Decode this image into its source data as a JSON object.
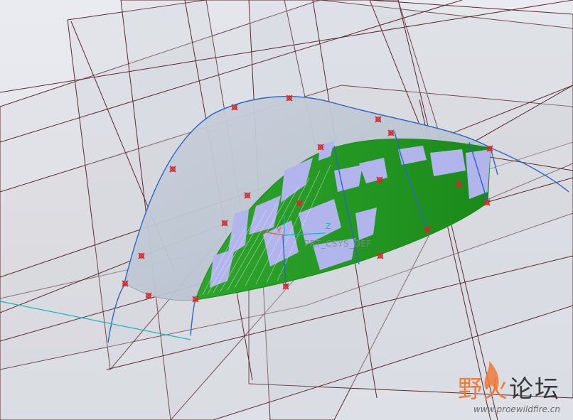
{
  "viewport": {
    "csys_label": "PRT_CSYS_DEF",
    "axis_z": "Z",
    "axis_y": "Y"
  },
  "watermark": {
    "title_part1": "野火",
    "title_part2": "论坛",
    "url": "www.proewildfire.cn"
  },
  "colors": {
    "background": "#e6e8ee",
    "datum_plane_edge": "#5a2a2e",
    "surface_shade": "#c3cad5",
    "curve": "#2a66c8",
    "mesh_green": "#1f9a1f",
    "mesh_lilac": "#b2b4ec",
    "vertex_marker": "#d22a2a",
    "axis_cyan": "#13b7c0"
  }
}
